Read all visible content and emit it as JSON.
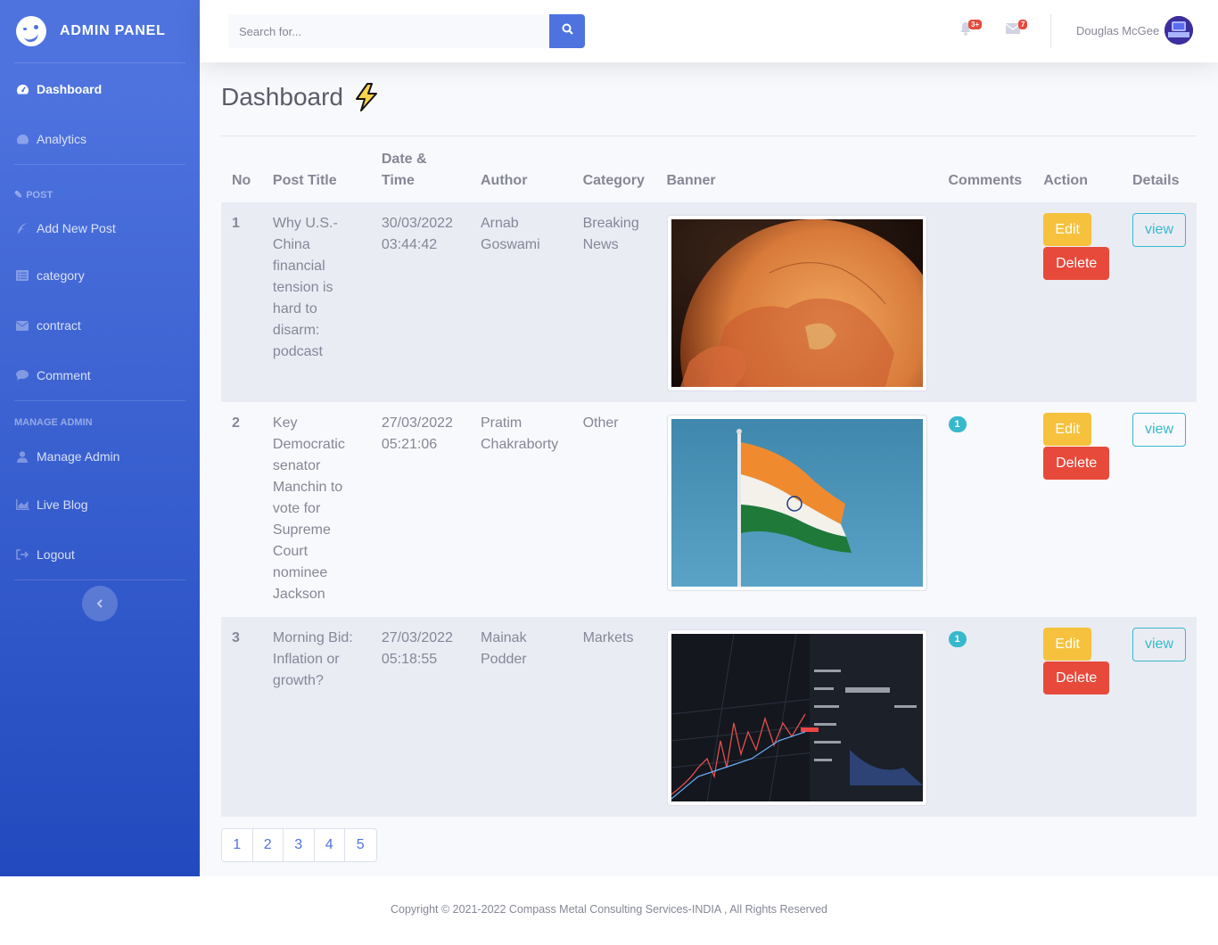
{
  "sidebar": {
    "brand": "ADMIN PANEL",
    "items": [
      {
        "label": "Dashboard",
        "icon": "dashboard-icon"
      },
      {
        "label": "Analytics",
        "icon": "analytics-icon"
      },
      {
        "label": "Add New Post",
        "icon": "feather-icon"
      },
      {
        "label": "category",
        "icon": "list-icon"
      },
      {
        "label": "contract",
        "icon": "envelope-icon"
      },
      {
        "label": "Comment",
        "icon": "comment-icon"
      },
      {
        "label": "Manage Admin",
        "icon": "user-icon"
      },
      {
        "label": "Live Blog",
        "icon": "chart-area-icon"
      },
      {
        "label": "Logout",
        "icon": "sign-out-icon"
      }
    ],
    "headings": {
      "post": "POST",
      "manage_admin": "MANAGE ADMIN"
    }
  },
  "topbar": {
    "search_placeholder": "Search for...",
    "alerts_badge": "3+",
    "messages_badge": "7",
    "user_name": "Douglas McGee"
  },
  "page": {
    "title": "Dashboard"
  },
  "table": {
    "headers": {
      "no": "No",
      "title": "Post Title",
      "date": "Date & Time",
      "author": "Author",
      "category": "Category",
      "banner": "Banner",
      "comments": "Comments",
      "action": "Action",
      "details": "Details"
    },
    "rows": [
      {
        "no": "1",
        "title": "Why U.S.-China financial tension is hard to disarm: podcast",
        "date": "30/03/2022 03:44:42",
        "author": "Arnab Goswami",
        "category": "Breaking News",
        "banner": "globe-image",
        "comments": "",
        "edit": "Edit",
        "delete": "Delete",
        "view": "view"
      },
      {
        "no": "2",
        "title": "Key Democratic senator Manchin to vote for Supreme Court nominee Jackson",
        "date": "27/03/2022 05:21:06",
        "author": "Pratim Chakraborty",
        "category": "Other",
        "banner": "flag-image",
        "comments": "1",
        "edit": "Edit",
        "delete": "Delete",
        "view": "view"
      },
      {
        "no": "3",
        "title": "Morning Bid: Inflation or growth?",
        "date": "27/03/2022 05:18:55",
        "author": "Mainak Podder",
        "category": "Markets",
        "banner": "stock-chart-image",
        "comments": "1",
        "edit": "Edit",
        "delete": "Delete",
        "view": "view"
      }
    ]
  },
  "pagination": [
    "1",
    "2",
    "3",
    "4",
    "5"
  ],
  "footer": {
    "text": "Copyright © 2021-2022 Compass Metal Consulting Services-INDIA , All Rights Reserved"
  },
  "colors": {
    "primary": "#4e73df",
    "warning": "#f6c23e",
    "danger": "#e74a3b",
    "info": "#36b9cc"
  }
}
